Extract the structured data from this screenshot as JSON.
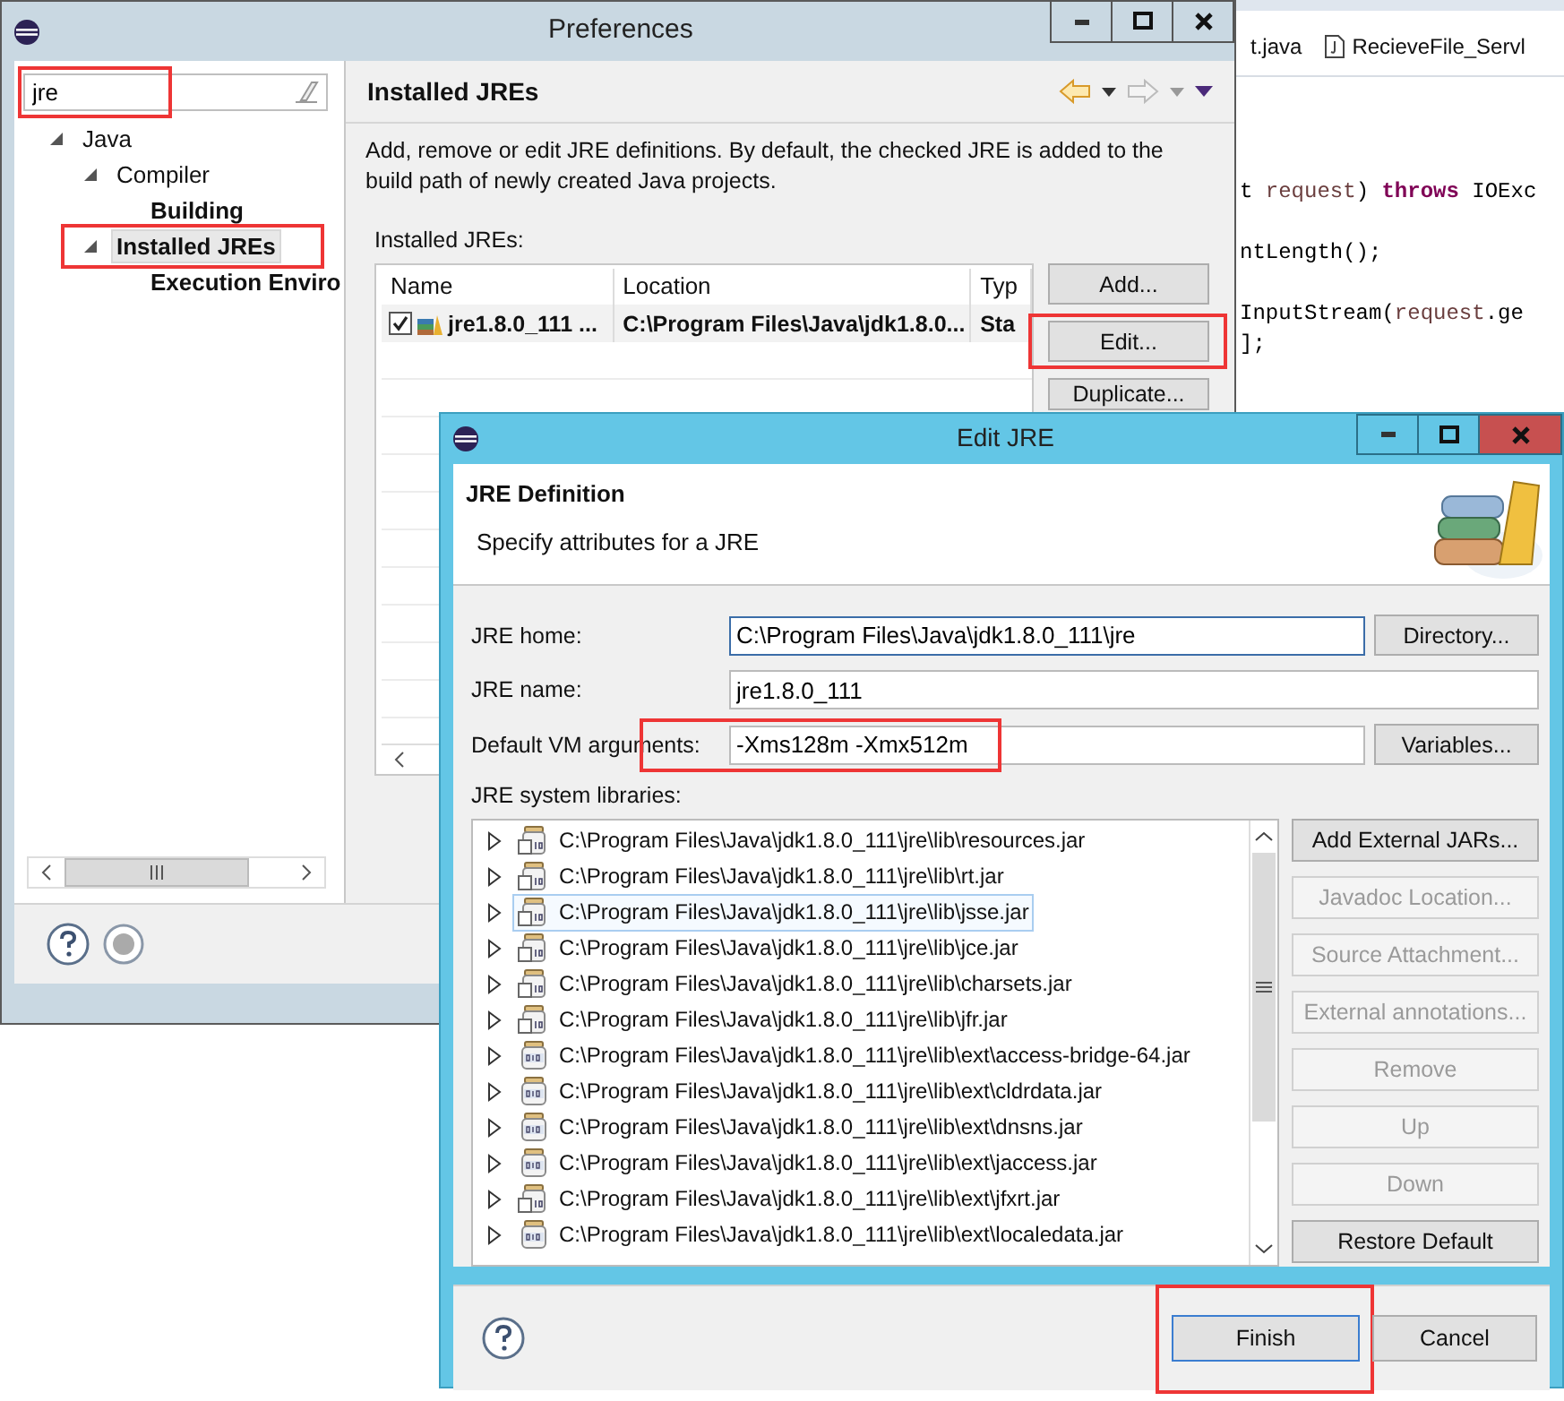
{
  "editor": {
    "tabs": [
      {
        "label": "t.java",
        "kind": "plain"
      },
      {
        "label": "RecieveFile_Servl",
        "kind": "file"
      }
    ],
    "code_lines": [
      {
        "blank_line_before": false,
        "segments": [
          {
            "text": "t ",
            "kind": "plain"
          },
          {
            "text": "request",
            "kind": "variable"
          },
          {
            "text": ") ",
            "kind": "plain"
          },
          {
            "text": "throws",
            "kind": "keyword"
          },
          {
            "text": " IOExc",
            "kind": "plain"
          }
        ]
      },
      {
        "blank_line_before": true,
        "segments": [
          {
            "text": "ntLength();",
            "kind": "plain"
          }
        ]
      },
      {
        "blank_line_before": true,
        "segments": [
          {
            "text": "InputStream(",
            "kind": "plain"
          },
          {
            "text": "request",
            "kind": "variable"
          },
          {
            "text": ".ge",
            "kind": "plain"
          }
        ]
      },
      {
        "blank_line_before": false,
        "segments": [
          {
            "text": "];",
            "kind": "plain"
          }
        ]
      }
    ]
  },
  "preferences": {
    "title": "Preferences",
    "filter": {
      "value": "jre",
      "highlighted": true
    },
    "tree": [
      {
        "label": "Java",
        "match": false,
        "selected": false,
        "highlighted": false,
        "expanded": true,
        "children": [
          {
            "label": "Compiler",
            "match": false,
            "selected": false,
            "highlighted": false,
            "expanded": true,
            "children": [
              {
                "label": "Building",
                "match": true,
                "selected": false,
                "highlighted": false
              }
            ]
          },
          {
            "label": "Installed JREs",
            "match": true,
            "selected": true,
            "highlighted": true,
            "expanded": true,
            "children": [
              {
                "label": "Execution Enviro",
                "match": true,
                "selected": false,
                "highlighted": false
              }
            ]
          }
        ]
      }
    ],
    "page": {
      "title": "Installed JREs",
      "description": "Add, remove or edit JRE definitions. By default, the checked JRE is added to the build path of newly created Java projects.",
      "table_label": "Installed JREs:",
      "columns": [
        "Name",
        "Location",
        "Typ"
      ],
      "rows": [
        {
          "checked": true,
          "name": "jre1.8.0_111 ...",
          "location": "C:\\Program Files\\Java\\jdk1.8.0...",
          "type": "Sta"
        }
      ],
      "buttons": [
        {
          "label": "Add...",
          "highlighted": false
        },
        {
          "label": "Edit...",
          "highlighted": true
        },
        {
          "label": "Duplicate...",
          "highlighted": false
        }
      ]
    }
  },
  "edit_jre": {
    "title": "Edit JRE",
    "heading": "JRE Definition",
    "subtitle": "Specify attributes for a JRE",
    "fields": [
      {
        "label": "JRE home:",
        "value": "C:\\Program Files\\Java\\jdk1.8.0_111\\jre",
        "focused": true,
        "highlighted": false,
        "button": "Directory..."
      },
      {
        "label": "JRE name:",
        "value": "jre1.8.0_111",
        "focused": false,
        "highlighted": false
      },
      {
        "label": "Default VM arguments:",
        "value": "-Xms128m -Xmx512m",
        "focused": false,
        "highlighted": true,
        "button": "Variables..."
      }
    ],
    "libraries_label": "JRE system libraries:",
    "libraries": [
      {
        "path": "C:\\Program Files\\Java\\jdk1.8.0_111\\jre\\lib\\resources.jar",
        "kind": "attached",
        "selected": false
      },
      {
        "path": "C:\\Program Files\\Java\\jdk1.8.0_111\\jre\\lib\\rt.jar",
        "kind": "attached",
        "selected": false
      },
      {
        "path": "C:\\Program Files\\Java\\jdk1.8.0_111\\jre\\lib\\jsse.jar",
        "kind": "attached",
        "selected": true
      },
      {
        "path": "C:\\Program Files\\Java\\jdk1.8.0_111\\jre\\lib\\jce.jar",
        "kind": "attached",
        "selected": false
      },
      {
        "path": "C:\\Program Files\\Java\\jdk1.8.0_111\\jre\\lib\\charsets.jar",
        "kind": "attached",
        "selected": false
      },
      {
        "path": "C:\\Program Files\\Java\\jdk1.8.0_111\\jre\\lib\\jfr.jar",
        "kind": "attached",
        "selected": false
      },
      {
        "path": "C:\\Program Files\\Java\\jdk1.8.0_111\\jre\\lib\\ext\\access-bridge-64.jar",
        "kind": "plain",
        "selected": false
      },
      {
        "path": "C:\\Program Files\\Java\\jdk1.8.0_111\\jre\\lib\\ext\\cldrdata.jar",
        "kind": "plain",
        "selected": false
      },
      {
        "path": "C:\\Program Files\\Java\\jdk1.8.0_111\\jre\\lib\\ext\\dnsns.jar",
        "kind": "plain",
        "selected": false
      },
      {
        "path": "C:\\Program Files\\Java\\jdk1.8.0_111\\jre\\lib\\ext\\jaccess.jar",
        "kind": "plain",
        "selected": false
      },
      {
        "path": "C:\\Program Files\\Java\\jdk1.8.0_111\\jre\\lib\\ext\\jfxrt.jar",
        "kind": "attached",
        "selected": false
      },
      {
        "path": "C:\\Program Files\\Java\\jdk1.8.0_111\\jre\\lib\\ext\\localedata.jar",
        "kind": "plain",
        "selected": false
      }
    ],
    "library_buttons": [
      {
        "label": "Add External JARs...",
        "disabled": false
      },
      {
        "label": "Javadoc Location...",
        "disabled": true
      },
      {
        "label": "Source Attachment...",
        "disabled": true
      },
      {
        "label": "External annotations...",
        "disabled": true
      },
      {
        "label": "Remove",
        "disabled": true
      },
      {
        "label": "Up",
        "disabled": true
      },
      {
        "label": "Down",
        "disabled": true
      },
      {
        "label": "Restore Default",
        "disabled": false
      }
    ],
    "buttons": [
      {
        "label": "Finish",
        "default": true,
        "highlighted": true
      },
      {
        "label": "Cancel",
        "default": false,
        "highlighted": false
      }
    ]
  }
}
